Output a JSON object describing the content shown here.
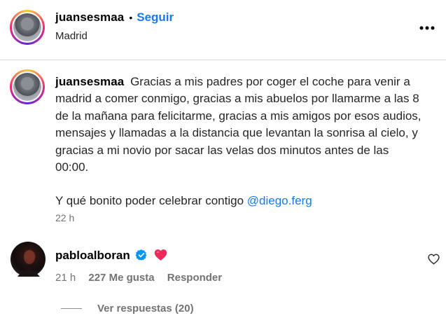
{
  "post": {
    "author": "juansesmaa",
    "separator": "•",
    "follow_label": "Seguir",
    "location": "Madrid",
    "more_icon": "more-horizontal-icon"
  },
  "caption": {
    "author": "juansesmaa",
    "text": "Gracias a mis padres por coger el coche para venir a madrid a comer conmigo, gracias a mis abuelos por llamarme a las 8 de la mañana para felicitarme, gracias a mis amigos por esos audios, mensajes y llamadas a la distancia que levantan la sonrisa al cielo, y gracias a mi novio por sacar las velas dos minutos antes de las 00:00.",
    "second_line": "Y qué bonito poder celebrar contigo",
    "mention": "@diego.ferg",
    "time": "22 h"
  },
  "comment": {
    "author": "pabloalboran",
    "verified_icon": "verified-badge-icon",
    "emoji_icon": "heart-emoji-icon",
    "time": "21 h",
    "likes": "227 Me gusta",
    "reply_label": "Responder",
    "like_icon": "heart-outline-icon",
    "view_replies": "Ver respuestas (20)"
  },
  "colors": {
    "link": "#1877f2",
    "secondary_text": "#737373",
    "divider": "#dbdbdb",
    "verified": "#0095f6",
    "heart": "#ed2a5a"
  }
}
